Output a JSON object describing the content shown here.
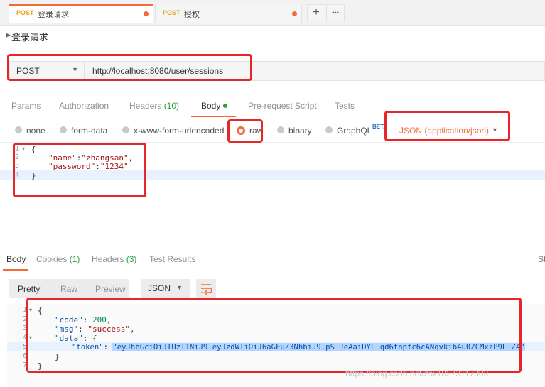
{
  "tabs": [
    {
      "method": "POST",
      "name": "登录请求",
      "active": true
    },
    {
      "method": "POST",
      "name": "授权",
      "active": false
    }
  ],
  "tab_actions": {
    "add_icon": "+",
    "more_icon": "•••"
  },
  "request": {
    "name": "登录请求",
    "method": "POST",
    "url": "http://localhost:8080/user/sessions"
  },
  "request_tabs": {
    "params": "Params",
    "authorization": "Authorization",
    "headers": "Headers",
    "headers_count": "(10)",
    "body": "Body",
    "prerequest": "Pre-request Script",
    "tests": "Tests"
  },
  "body_types": {
    "none": "none",
    "form_data": "form-data",
    "urlencoded": "x-www-form-urlencoded",
    "raw": "raw",
    "binary": "binary",
    "graphql": "GraphQL",
    "beta": "BETA",
    "content_type": "JSON (application/json)"
  },
  "request_body": {
    "line_numbers": [
      "1",
      "2",
      "3",
      "4"
    ],
    "open_brace": "{",
    "name_key": "\"name\"",
    "colon": ":",
    "name_value": "\"zhangsan\"",
    "comma": ",",
    "password_key": "\"password\"",
    "password_value": "\"1234\"",
    "close_brace": "}"
  },
  "response_tabs": {
    "body": "Body",
    "cookies": "Cookies",
    "cookies_count": "(1)",
    "headers": "Headers",
    "headers_count": "(3)",
    "test_results": "Test Results",
    "status_cut": "St"
  },
  "response_toolbar": {
    "pretty": "Pretty",
    "raw": "Raw",
    "preview": "Preview",
    "format": "JSON"
  },
  "response_body": {
    "line_numbers": [
      "1",
      "2",
      "3",
      "4",
      "5",
      "6",
      "7"
    ],
    "l1": "{",
    "code_key": "\"code\"",
    "code_value": "200",
    "msg_key": "\"msg\"",
    "msg_value": "\"success\"",
    "data_key": "\"data\"",
    "data_open": "{",
    "token_key": "\"token\"",
    "token_value": "\"eyJhbGciOiJIUzI1NiJ9.eyJzdWIiOiJ6aGFuZ3NhbiJ9.pS_JeAaiDYL_qd6tnpfc6cANqvkib4u0ZCMxzP9L_Z4\"",
    "data_close": "}",
    "close": "}"
  },
  "watermark": "https://blog.csdn.net/zsx18273117003",
  "colors": {
    "accent": "#f26b3a",
    "annotation": "#e8262a",
    "count_green": "#2aa33b"
  }
}
